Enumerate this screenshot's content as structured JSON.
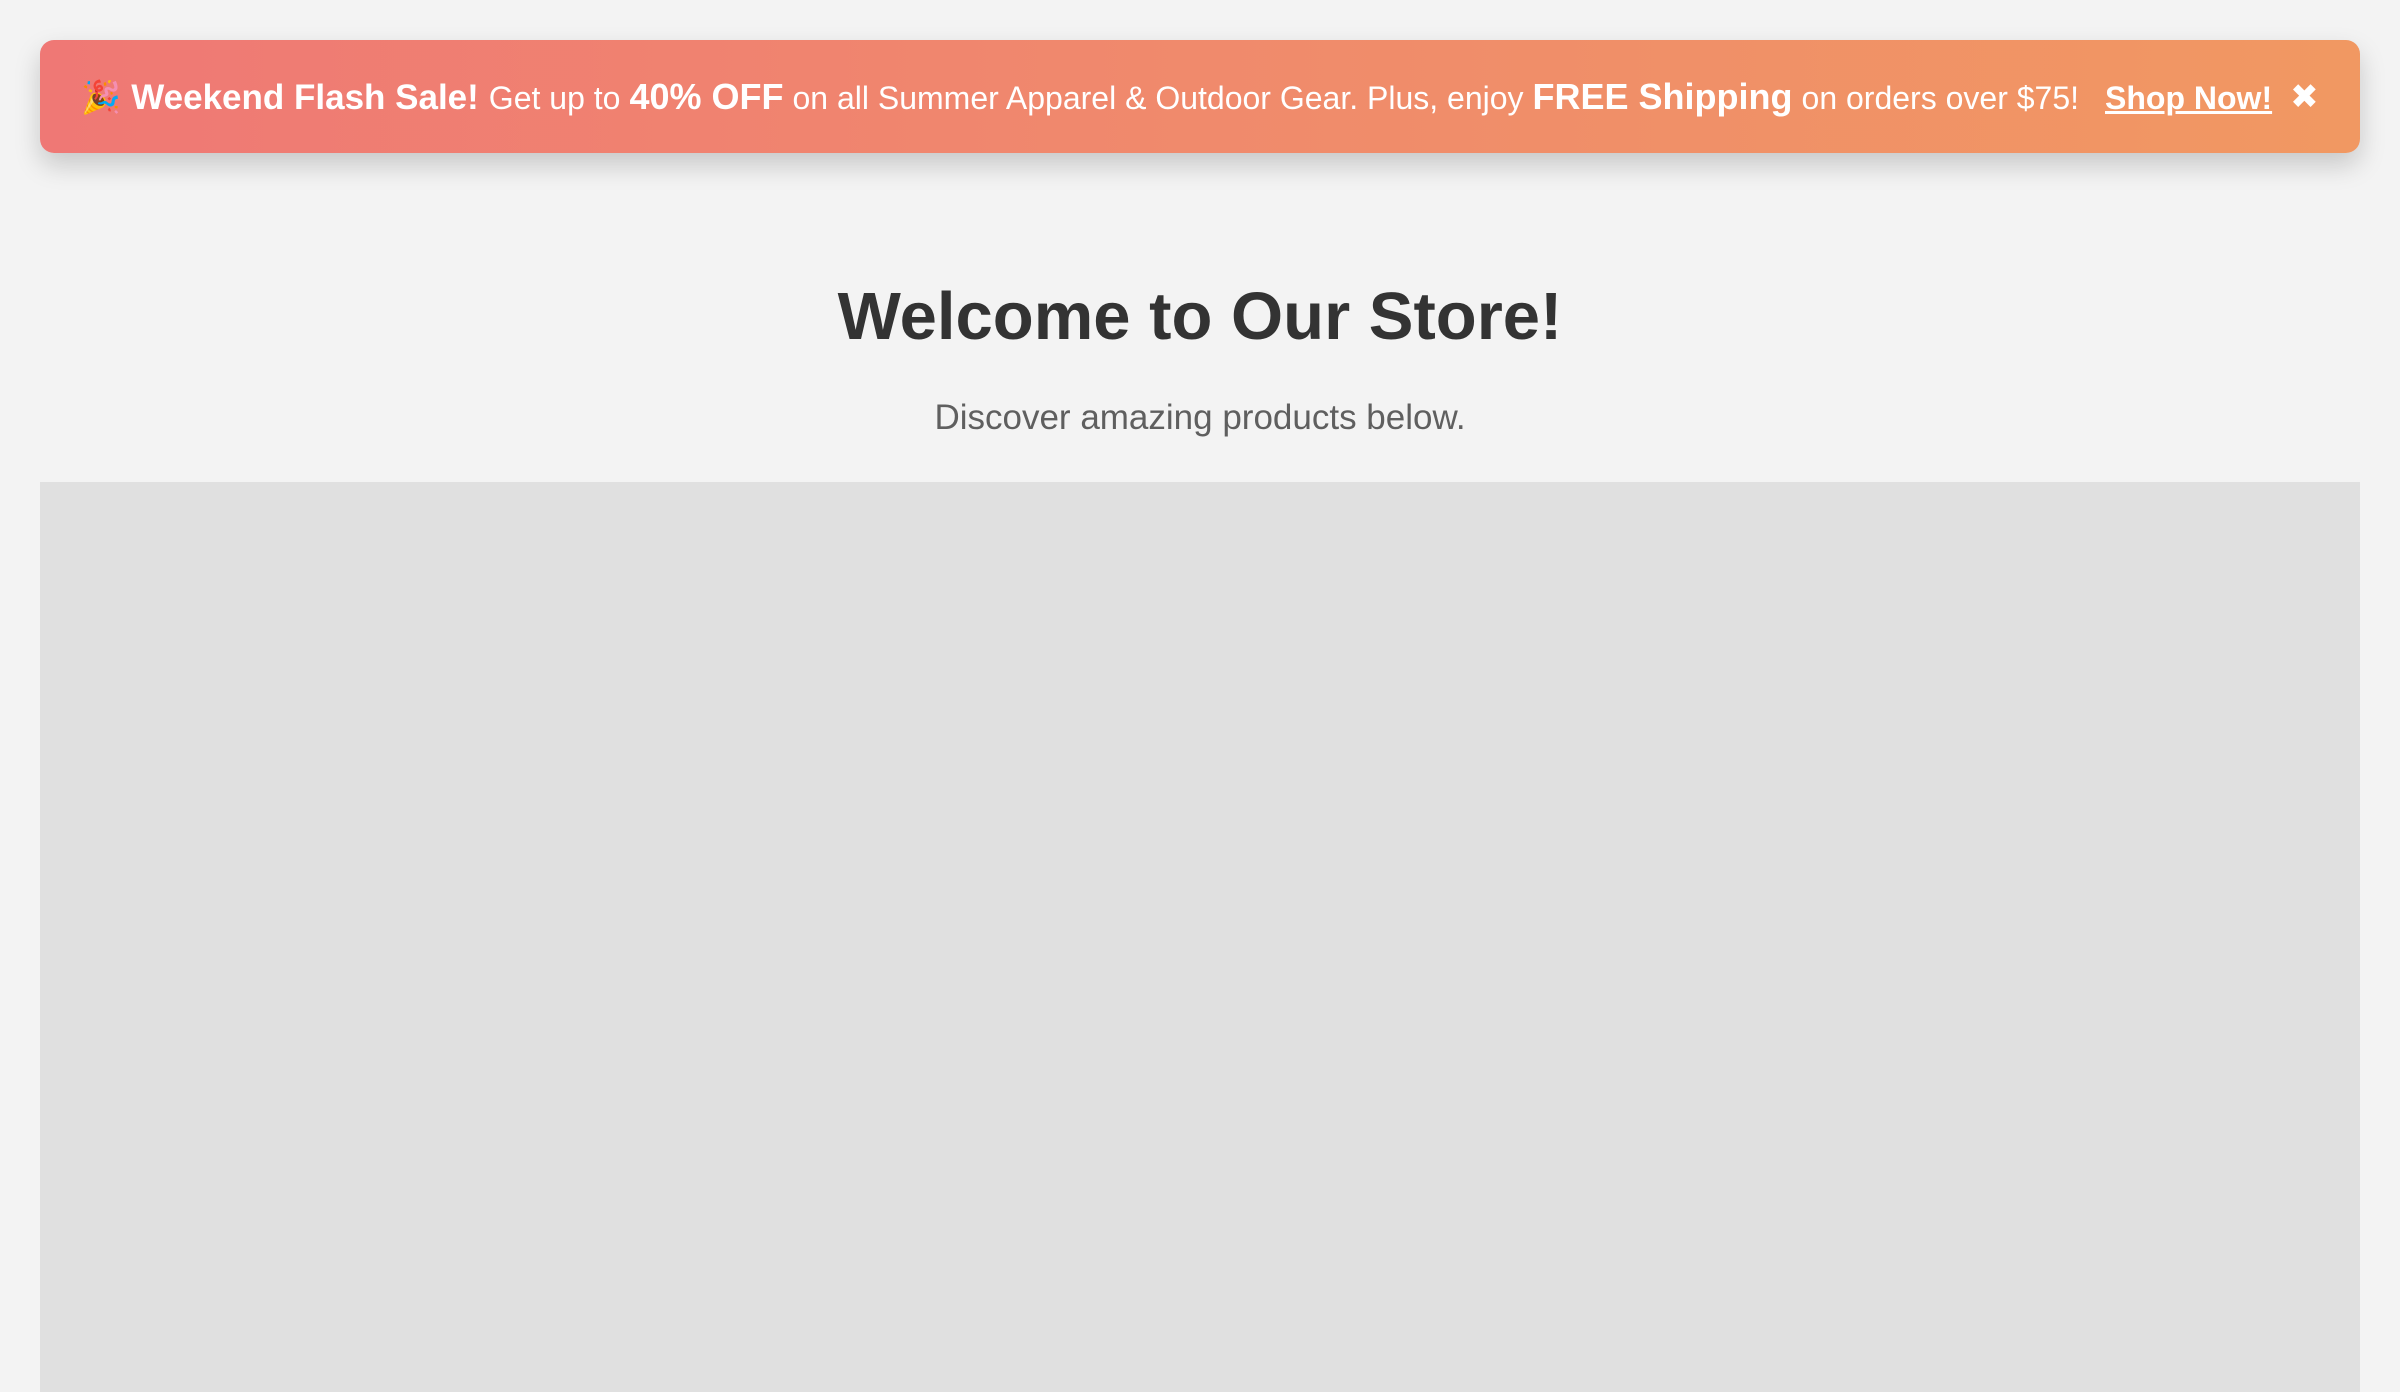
{
  "banner": {
    "icon": "party-popper-icon",
    "icon_glyph": "🎉",
    "title": "Weekend Flash Sale!",
    "text_1": "Get up to",
    "discount": "40% OFF",
    "text_2": "on all Summer Apparel & Outdoor Gear. Plus, enjoy",
    "shipping": "FREE Shipping",
    "text_3": "on orders over $75!",
    "cta_label": "Shop Now!",
    "close_glyph": "✖",
    "colors": {
      "gradient_start": "#ef7875",
      "gradient_end": "#f19862",
      "text": "#ffffff"
    }
  },
  "main": {
    "title": "Welcome to Our Store!",
    "subtitle": "Discover amazing products below."
  }
}
